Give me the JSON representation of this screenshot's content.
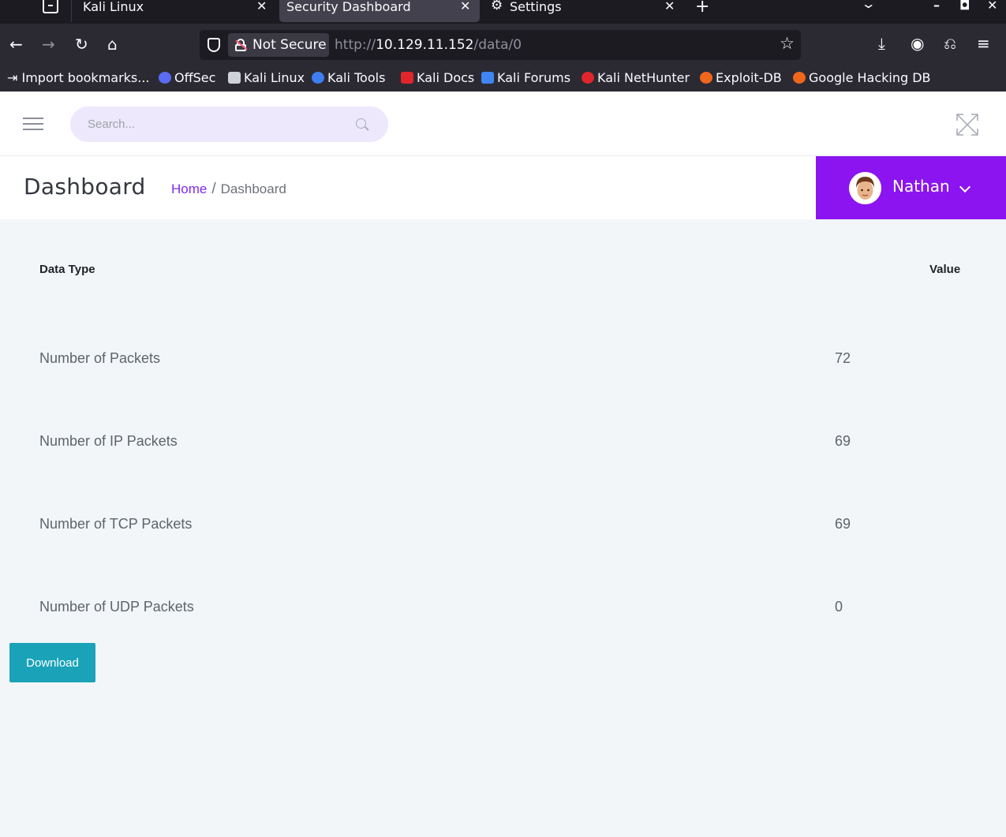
{
  "browser": {
    "tabs": [
      {
        "label": "Kali Linux"
      },
      {
        "label": "Security Dashboard"
      },
      {
        "label": "Settings"
      }
    ],
    "security_label": "Not Secure",
    "url": {
      "scheme": "http://",
      "host": "10.129.11.152",
      "path": "/data/0"
    },
    "bookmarks": [
      {
        "label": "Import bookmarks...",
        "color": "#fbfbfe"
      },
      {
        "label": "OffSec",
        "color": "#5b6cf2"
      },
      {
        "label": "Kali Linux",
        "color": "#cfd2d6"
      },
      {
        "label": "Kali Tools",
        "color": "#3d7ff0"
      },
      {
        "label": "Kali Docs",
        "color": "#e0252b"
      },
      {
        "label": "Kali Forums",
        "color": "#3f86f2"
      },
      {
        "label": "Kali NetHunter",
        "color": "#e0252b"
      },
      {
        "label": "Exploit-DB",
        "color": "#f0661c"
      },
      {
        "label": "Google Hacking DB",
        "color": "#f0661c"
      }
    ]
  },
  "topbar": {
    "search_placeholder": "Search..."
  },
  "header": {
    "title": "Dashboard",
    "breadcrumb": {
      "home": "Home",
      "separator": "/",
      "current": "Dashboard"
    },
    "user": {
      "name": "Nathan"
    }
  },
  "table": {
    "columns": [
      "Data Type",
      "Value"
    ],
    "rows": [
      {
        "type": "Number of Packets",
        "value": "72"
      },
      {
        "type": "Number of IP Packets",
        "value": "69"
      },
      {
        "type": "Number of TCP Packets",
        "value": "69"
      },
      {
        "type": "Number of UDP Packets",
        "value": "0"
      }
    ]
  },
  "actions": {
    "download_label": "Download"
  },
  "colors": {
    "accent": "#8b14f1",
    "download": "#1aa3b8",
    "link": "#7f2bf0"
  }
}
